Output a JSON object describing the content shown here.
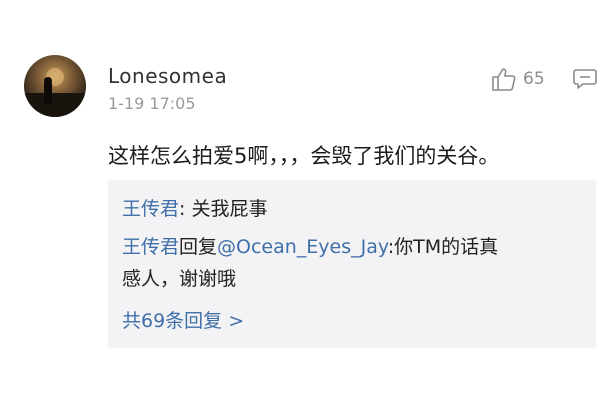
{
  "comment": {
    "username": "Lonesomea",
    "timestamp": "1-19 17:05",
    "likes": "65",
    "text": "这样怎么拍爱5啊，，，会毁了我们的关谷。",
    "icons": {
      "avatar": "avatar",
      "like": "thumbs-up-icon",
      "reply": "comment-icon"
    }
  },
  "replies": {
    "items": [
      {
        "author": "王传君",
        "colon": ": ",
        "text": "关我屁事"
      },
      {
        "author": "王传君",
        "reply_word": "回复",
        "mention": "@Ocean_Eyes_Jay",
        "text_line1": ":你TM的话真",
        "text_line2": "感人，谢谢哦"
      }
    ],
    "more_label": "共69条回复",
    "more_chevron": ">"
  },
  "colors": {
    "link": "#3f6fa8",
    "timestamp": "#9a9a9a",
    "reply_bg": "#f3f3f5"
  }
}
